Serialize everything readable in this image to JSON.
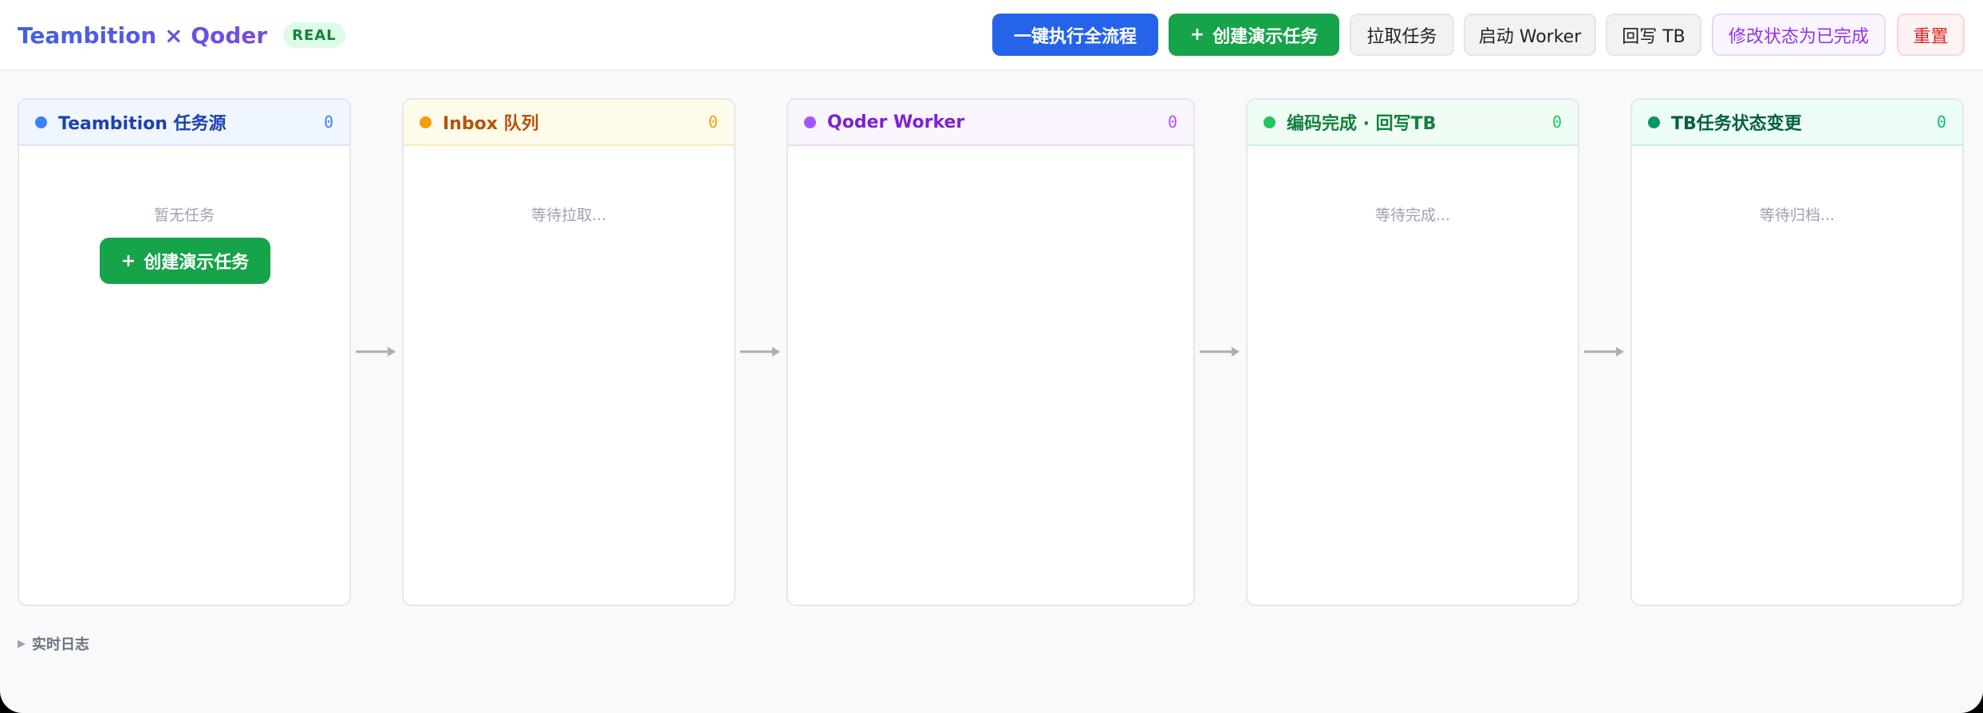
{
  "header": {
    "title": "Teambition × Qoder",
    "badge": "REAL",
    "buttons": {
      "run_all": "一键执行全流程",
      "create_demo": "创建演示任务",
      "pull": "拉取任务",
      "start_worker": "启动 Worker",
      "write_back": "回写 TB",
      "mark_done": "修改状态为已完成",
      "reset": "重置"
    }
  },
  "columns": [
    {
      "title": "Teambition 任务源",
      "count": "0",
      "empty_text": "暂无任务",
      "cta": "创建演示任务",
      "color": "#3b82f6"
    },
    {
      "title": "Inbox 队列",
      "count": "0",
      "empty_text": "等待拉取...",
      "color": "#f59e0b"
    },
    {
      "title": "Qoder Worker",
      "count": "0",
      "empty_text": "",
      "color": "#a855f7"
    },
    {
      "title": "编码完成 · 回写TB",
      "count": "0",
      "empty_text": "等待完成...",
      "color": "#22c55e"
    },
    {
      "title": "TB任务状态变更",
      "count": "0",
      "empty_text": "等待归档...",
      "color": "#059669"
    }
  ],
  "log": {
    "label": "实时日志"
  },
  "icons": {
    "plus": "+",
    "arrow": "arrow-right-icon",
    "disclosure": "▶"
  }
}
